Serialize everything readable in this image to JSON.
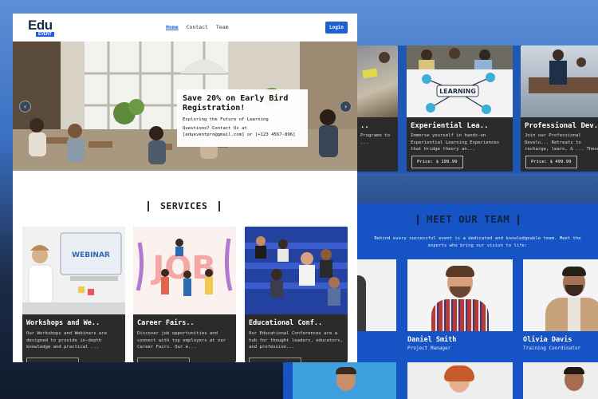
{
  "site": {
    "logo_text": "Edu",
    "logo_badge": "EVENT",
    "nav": [
      "Home",
      "Contact",
      "Team"
    ],
    "login_label": "Login"
  },
  "hero": {
    "promo_title": "Save 20% on Early Bird Registration!",
    "promo_sub1": "Exploring the Future of Learning",
    "promo_sub2": "Questions? Contact Us at [edueventpro@gmail.com] or [+123 4567-896]",
    "prev_icon": "chevron-left-icon",
    "next_icon": "chevron-right-icon"
  },
  "services": {
    "heading": "SERVICES",
    "cards": [
      {
        "title": "Workshops and We..",
        "desc": "Our Workshops and Webinars are designed to provide in-depth knowledge and practical ..."
      },
      {
        "title": "Career Fairs..",
        "desc": "Discover job opportunities and connect with top employers at our Career Fairs. Our e..."
      },
      {
        "title": "Educational Conf..",
        "desc": "Our Educational Conferences are a hub for thought leaders, educators, and profession..."
      }
    ]
  },
  "courses": {
    "cards": [
      {
        "title": "..",
        "desc": "Programs to ..."
      },
      {
        "title": "Experiential Lea..",
        "desc": "Immerse yourself in hands-on Experiential Learning Experiences that bridge theory an...",
        "price": "Price: $ 199.99",
        "image_text": "LEARNING"
      },
      {
        "title": "Professional Dev..",
        "desc": "Join our Professional Develo... Retreats to recharge, learn, & ... These retre...",
        "price": "Price: $ 499.99"
      }
    ]
  },
  "team": {
    "heading": "MEET OUR TEAM",
    "subtitle": "Behind every successful event is a dedicated and knowledgeable team. Meet the experts who bring our vision to life:",
    "members": [
      {
        "name": "Daniel Smith",
        "role": "Project Manager"
      },
      {
        "name": "Olivia Davis",
        "role": "Training Coordinator"
      }
    ]
  },
  "webinar_screen_text": "WEBINAR",
  "job_text": "JOB"
}
